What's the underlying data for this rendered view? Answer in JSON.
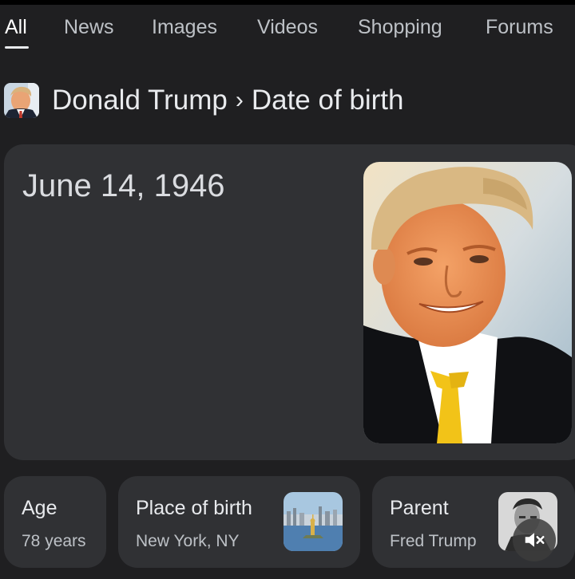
{
  "tabs": [
    {
      "label": "All",
      "active": true
    },
    {
      "label": "News"
    },
    {
      "label": "Images"
    },
    {
      "label": "Videos"
    },
    {
      "label": "Shopping"
    },
    {
      "label": "Forums"
    }
  ],
  "breadcrumb": {
    "entity": "Donald Trump",
    "separator": "›",
    "attribute": "Date of birth"
  },
  "answer": {
    "date_of_birth": "June 14, 1946"
  },
  "related": [
    {
      "title": "Age",
      "value": "78 years"
    },
    {
      "title": "Place of birth",
      "value": "New York, NY"
    },
    {
      "title": "Parent",
      "value": "Fred Trump"
    }
  ],
  "icons": {
    "mute": "speaker-muted-icon"
  },
  "colors": {
    "background": "#1f1f21",
    "card": "#303134",
    "text": "#e8eaed",
    "tie": "#f2c318"
  }
}
